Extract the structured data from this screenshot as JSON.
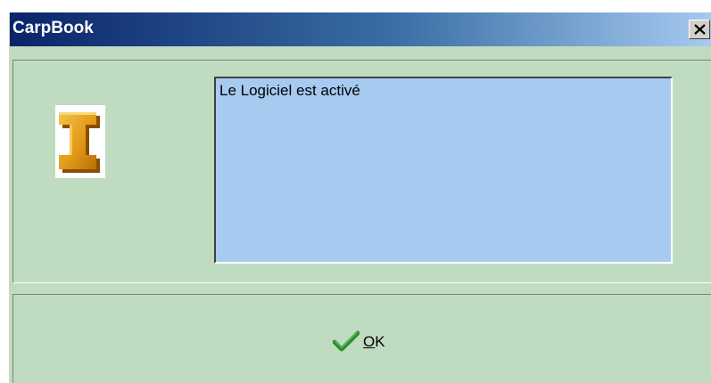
{
  "window": {
    "title": "CarpBook",
    "close_icon": "close-icon",
    "info_icon": "information-i-icon"
  },
  "message": {
    "text": "Le Logiciel est activé"
  },
  "ok_button": {
    "icon": "checkmark-icon",
    "mnemonic": "O",
    "label_rest": "K"
  },
  "colors": {
    "dialog_background": "#c0dcc0",
    "message_background": "#a6caf0",
    "titlebar_start": "#0a246a",
    "titlebar_end": "#a6caf0",
    "checkmark": "#2e8b2e",
    "icon_gold": "#e0a020"
  }
}
